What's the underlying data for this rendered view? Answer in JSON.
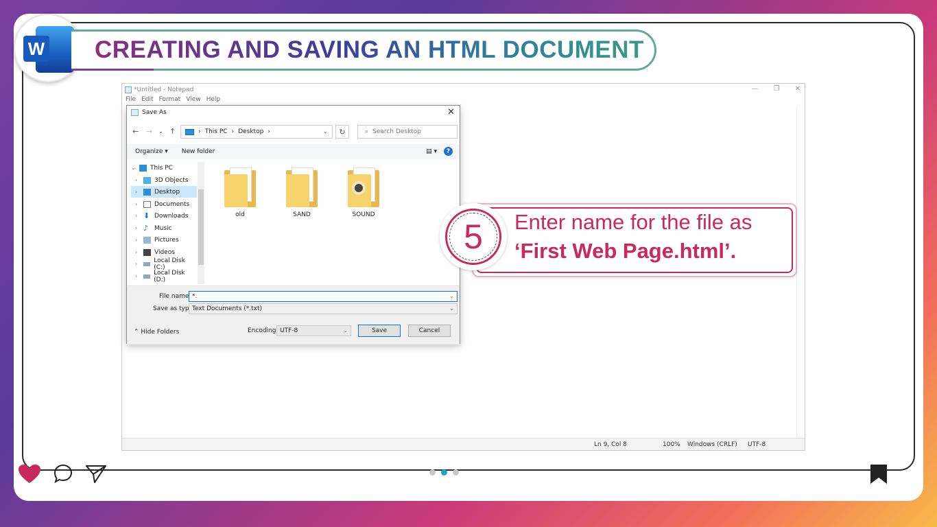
{
  "header": {
    "title": "CREATING AND SAVING AN HTML DOCUMENT",
    "app_logo_letter": "W"
  },
  "notepad": {
    "title": "*Untitled - Notepad",
    "menu": [
      "File",
      "Edit",
      "Format",
      "View",
      "Help"
    ],
    "status": {
      "position": "Ln 9, Col 8",
      "zoom": "100%",
      "line_ending": "Windows (CRLF)",
      "encoding": "UTF-8"
    }
  },
  "dialog": {
    "title": "Save As",
    "breadcrumb": [
      "This PC",
      "Desktop"
    ],
    "search_placeholder": "Search Desktop",
    "toolbar": {
      "organize": "Organize",
      "new_folder": "New folder"
    },
    "tree": [
      {
        "label": "This PC",
        "icon": "monitor-icon"
      },
      {
        "label": "3D Objects",
        "icon": "cube-icon"
      },
      {
        "label": "Desktop",
        "icon": "desktop-icon",
        "selected": true
      },
      {
        "label": "Documents",
        "icon": "document-icon"
      },
      {
        "label": "Downloads",
        "icon": "download-icon"
      },
      {
        "label": "Music",
        "icon": "music-icon"
      },
      {
        "label": "Pictures",
        "icon": "picture-icon"
      },
      {
        "label": "Videos",
        "icon": "video-icon"
      },
      {
        "label": "Local Disk (C:)",
        "icon": "drive-icon"
      },
      {
        "label": "Local Disk (D:)",
        "icon": "drive-icon"
      }
    ],
    "files": [
      "old",
      "SAND",
      "SOUND"
    ],
    "file_name_label": "File name:",
    "file_name_value": "*.",
    "save_type_label": "Save as type:",
    "save_type_value": "Text Documents (*.txt)",
    "hide_folders": "Hide Folders",
    "encoding_label": "Encoding:",
    "encoding_value": "UTF-8",
    "save_label": "Save",
    "cancel_label": "Cancel"
  },
  "callout": {
    "step": "5",
    "line1": "Enter name for the file as",
    "line2": "‘First Web Page.html’."
  },
  "footer": {
    "dots": 3,
    "active_dot": 2
  },
  "colors": {
    "accent": "#c92a5e",
    "teal": "#1aa3c9"
  }
}
